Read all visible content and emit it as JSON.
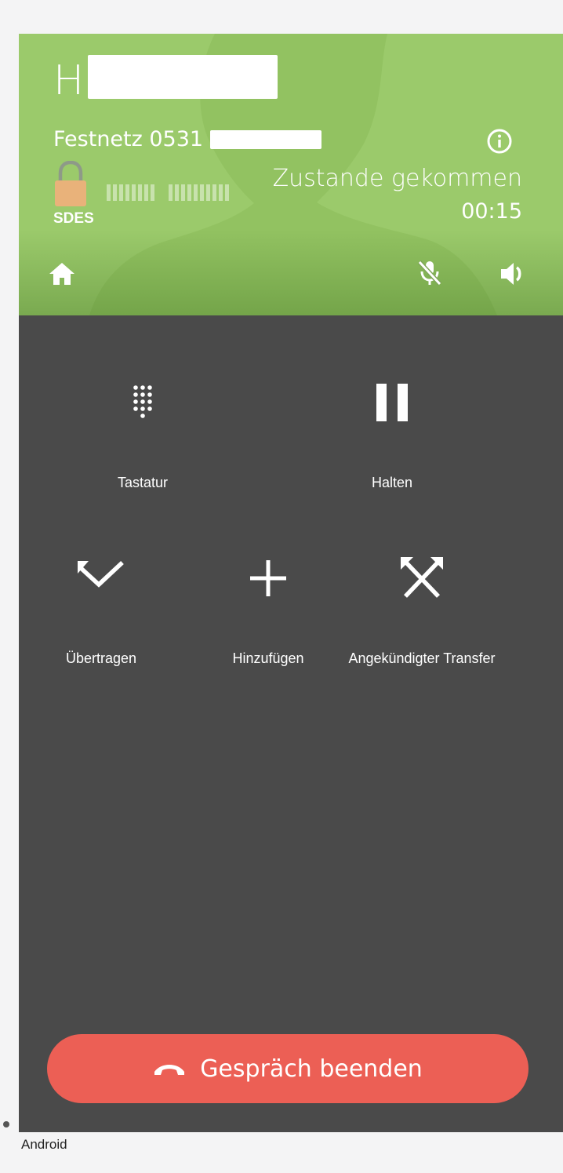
{
  "call": {
    "contact_initial": "H",
    "number_prefix": "Festnetz 0531",
    "encryption": "SDES",
    "status": "Zustande gekommen",
    "timer": "00:15"
  },
  "header_icons": {
    "info": "info-icon",
    "home": "home-icon",
    "mute": "mic-off-icon",
    "speaker": "speaker-icon",
    "lock": "lock-icon"
  },
  "actions": {
    "keypad": {
      "label": "Tastatur",
      "icon": "dialpad-icon"
    },
    "hold": {
      "label": "Halten",
      "icon": "pause-icon"
    },
    "transfer": {
      "label": "Übertragen",
      "icon": "transfer-icon"
    },
    "add": {
      "label": "Hinzufügen",
      "icon": "add-icon"
    },
    "attended_transfer": {
      "label": "Angekündigter Transfer",
      "icon": "attended-transfer-icon"
    }
  },
  "end_call": {
    "label": "Gespräch beenden",
    "icon": "hang-up-icon"
  },
  "footer": {
    "platform": "Android"
  },
  "colors": {
    "header_green": "#9bca6b",
    "body_dark": "#4a4a4a",
    "end_call_red": "#ec5f55",
    "lock_orange": "#e9b27a"
  }
}
